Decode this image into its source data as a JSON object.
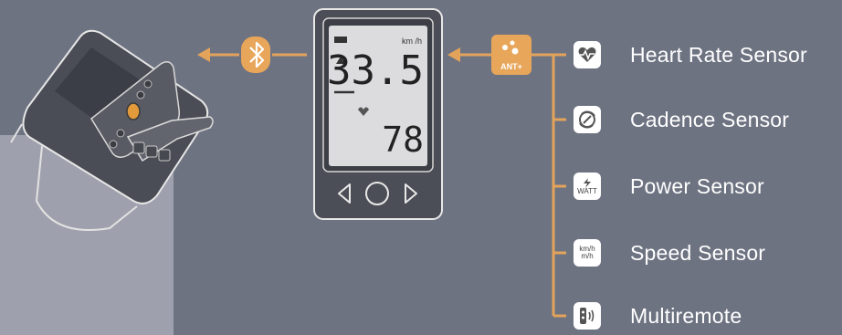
{
  "device": {
    "unit_label": "km /h",
    "speed_value": "33.5",
    "cadence_value": "78"
  },
  "ant_badge": "ANT+",
  "sensors": [
    {
      "label": "Heart Rate Sensor",
      "icon": "heart-pulse-icon"
    },
    {
      "label": "Cadence Sensor",
      "icon": "cadence-rotation-icon"
    },
    {
      "label": "Power Sensor",
      "icon": "power-watt-icon",
      "icon_text": "WATT"
    },
    {
      "label": "Speed Sensor",
      "icon": "speed-kmh-icon",
      "icon_text_1": "km/h",
      "icon_text_2": "m/h"
    },
    {
      "label": "Multiremote",
      "icon": "multiremote-icon"
    }
  ],
  "colors": {
    "background": "#6e7382",
    "accent_orange": "#e8a65a",
    "line_orange": "#e3a35b",
    "screen": "#dcdcde"
  }
}
